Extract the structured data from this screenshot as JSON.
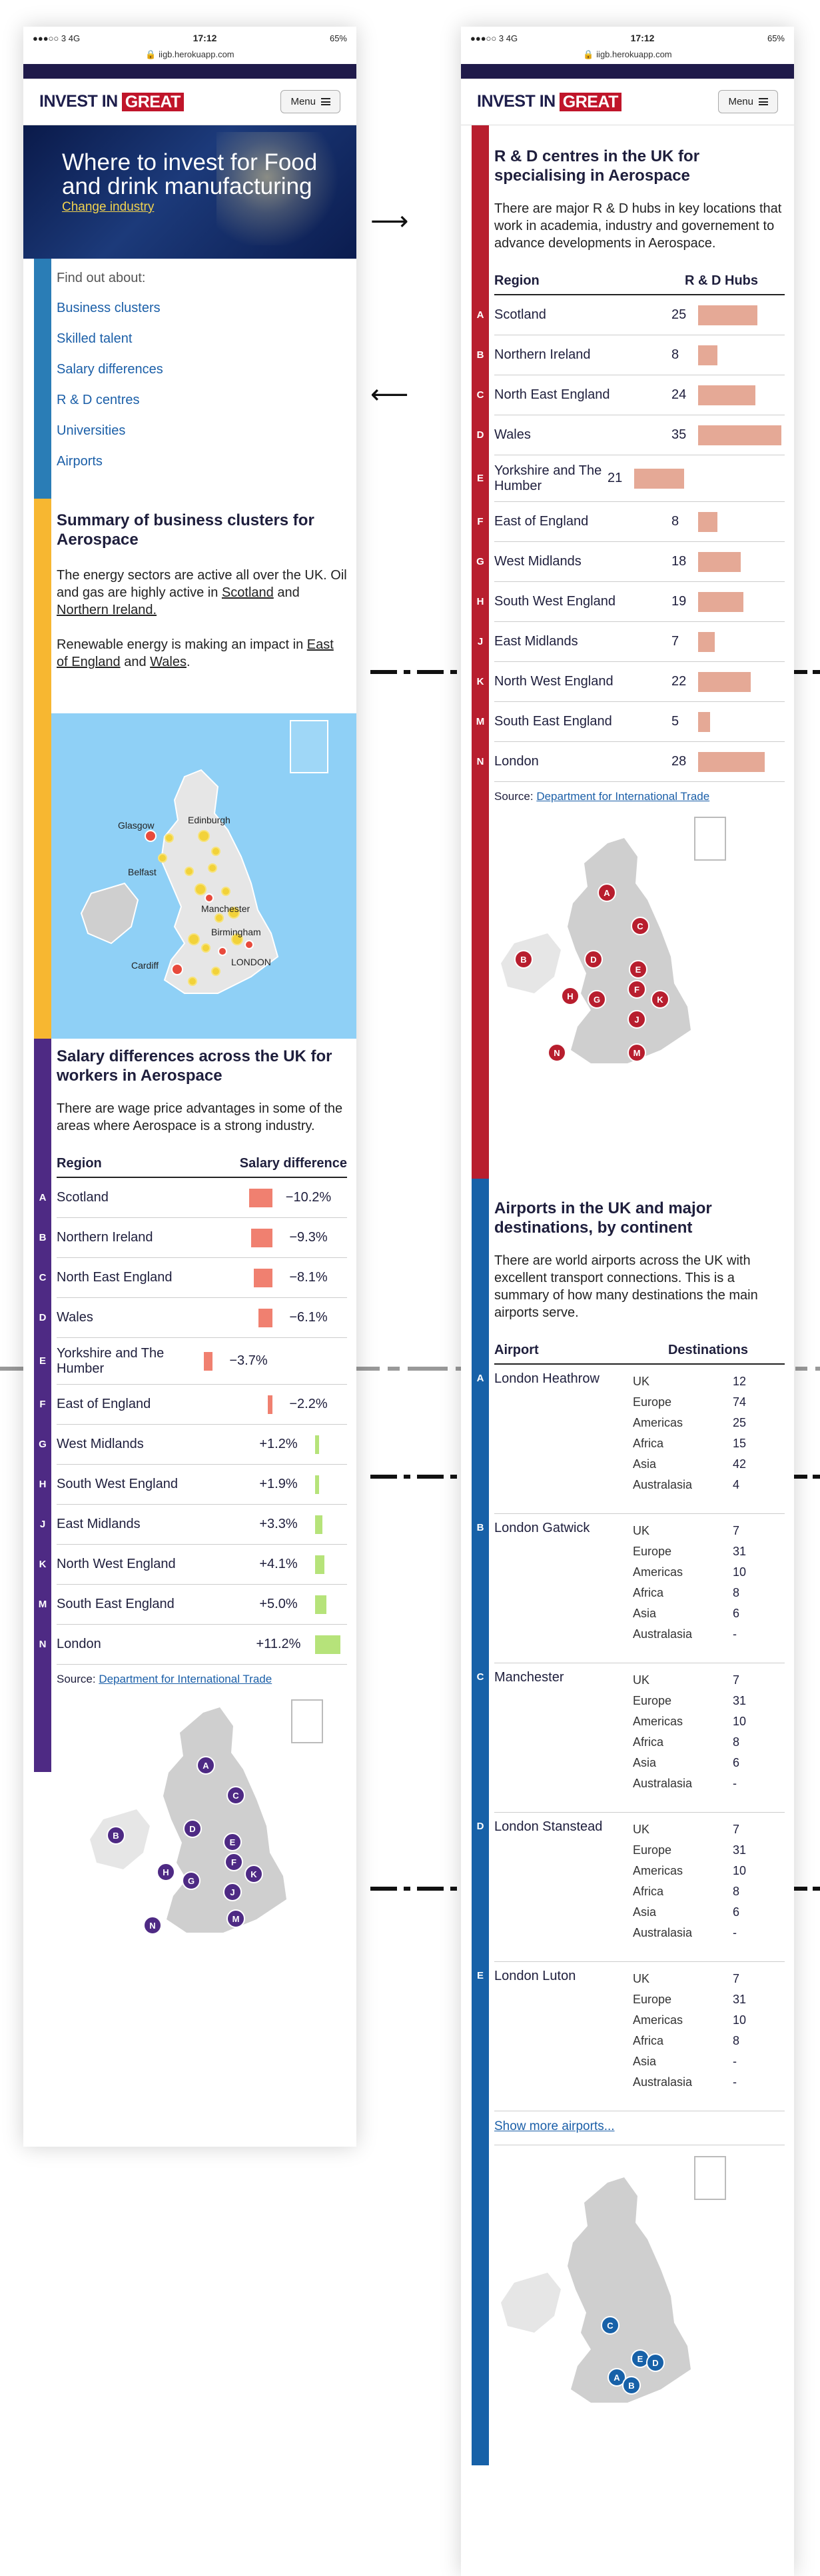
{
  "status": {
    "carrier": "●●●○○ 3  4G",
    "time": "17:12",
    "battery": "65%"
  },
  "url": "iigb.herokuapp.com",
  "logo": {
    "text": "INVEST IN",
    "badge": "GREAT"
  },
  "menu_label": "Menu",
  "hero": {
    "title": "Where to invest for Food and drink manufacturing",
    "change": "Change industry"
  },
  "findout": {
    "label": "Find out about:",
    "links": [
      "Business clusters",
      "Skilled talent",
      "Salary differences",
      "R & D centres",
      "Universities",
      "Airports"
    ]
  },
  "clusters": {
    "title": "Summary of business clusters for Aerospace",
    "p1_pre": "The energy sectors are active all over the UK. Oil and gas are highly active in ",
    "p1_l1": "Scotland",
    "p1_mid": " and ",
    "p1_l2": "Northern Ireland.",
    "p2_pre": "Renewable energy is making an impact in ",
    "p2_l1": "East of England",
    "p2_mid": " and ",
    "p2_l2": "Wales",
    "p2_end": "."
  },
  "cluster_map_labels": [
    "Glasgow",
    "Edinburgh",
    "Belfast",
    "Manchester",
    "Birmingham",
    "Cardiff",
    "LONDON"
  ],
  "salary": {
    "title": "Salary differences across the UK for workers in Aerospace",
    "intro": "There are wage price advantages in some of the areas where Aerospace is a strong industry.",
    "col1": "Region",
    "col2": "Salary difference",
    "rows": [
      {
        "letter": "A",
        "region": "Scotland",
        "value": "−10.2%",
        "num": -10.2
      },
      {
        "letter": "B",
        "region": "Northern Ireland",
        "value": "−9.3%",
        "num": -9.3
      },
      {
        "letter": "C",
        "region": "North East England",
        "value": "−8.1%",
        "num": -8.1
      },
      {
        "letter": "D",
        "region": "Wales",
        "value": "−6.1%",
        "num": -6.1
      },
      {
        "letter": "E",
        "region": "Yorkshire and The Humber",
        "value": "−3.7%",
        "num": -3.7
      },
      {
        "letter": "F",
        "region": "East of England",
        "value": "−2.2%",
        "num": -2.2
      },
      {
        "letter": "G",
        "region": "West Midlands",
        "value": "+1.2%",
        "num": 1.2
      },
      {
        "letter": "H",
        "region": "South West England",
        "value": "+1.9%",
        "num": 1.9
      },
      {
        "letter": "J",
        "region": "East Midlands",
        "value": "+3.3%",
        "num": 3.3
      },
      {
        "letter": "K",
        "region": "North West England",
        "value": "+4.1%",
        "num": 4.1
      },
      {
        "letter": "M",
        "region": "South East England",
        "value": "+5.0%",
        "num": 5.0
      },
      {
        "letter": "N",
        "region": "London",
        "value": "+11.2%",
        "num": 11.2
      }
    ],
    "source_label": "Source: ",
    "source_link": "Department for International Trade"
  },
  "rd": {
    "title": "R & D centres in the UK for specialising in Aerospace",
    "intro": "There are major R & D hubs in key locations that work in academia, industry and governement to advance developments in Aerospace.",
    "col1": "Region",
    "col2": "R & D Hubs",
    "rows": [
      {
        "letter": "A",
        "region": "Scotland",
        "value": "25",
        "num": 25
      },
      {
        "letter": "B",
        "region": "Northern Ireland",
        "value": "8",
        "num": 8
      },
      {
        "letter": "C",
        "region": "North East England",
        "value": "24",
        "num": 24
      },
      {
        "letter": "D",
        "region": "Wales",
        "value": "35",
        "num": 35
      },
      {
        "letter": "E",
        "region": "Yorkshire and The Humber",
        "value": "21",
        "num": 21
      },
      {
        "letter": "F",
        "region": "East of England",
        "value": "8",
        "num": 8
      },
      {
        "letter": "G",
        "region": "West Midlands",
        "value": "18",
        "num": 18
      },
      {
        "letter": "H",
        "region": "South West England",
        "value": "19",
        "num": 19
      },
      {
        "letter": "J",
        "region": "East Midlands",
        "value": "7",
        "num": 7
      },
      {
        "letter": "K",
        "region": "North West England",
        "value": "22",
        "num": 22
      },
      {
        "letter": "M",
        "region": "South East England",
        "value": "5",
        "num": 5
      },
      {
        "letter": "N",
        "region": "London",
        "value": "28",
        "num": 28
      }
    ],
    "source_label": "Source: ",
    "source_link": "Department for International Trade"
  },
  "airports": {
    "title": "Airports in the UK and major destinations, by continent",
    "intro": "There are world airports across the UK with excellent transport connections. This is a summary of how many destinations the main airports serve.",
    "col1": "Airport",
    "col2": "Destinations",
    "continents": [
      "UK",
      "Europe",
      "Americas",
      "Africa",
      "Asia",
      "Australasia"
    ],
    "rows": [
      {
        "letter": "A",
        "name": "London Heathrow",
        "counts": [
          "12",
          "74",
          "25",
          "15",
          "42",
          "4"
        ]
      },
      {
        "letter": "B",
        "name": "London Gatwick",
        "counts": [
          "7",
          "31",
          "10",
          "8",
          "6",
          "-"
        ]
      },
      {
        "letter": "C",
        "name": "Manchester",
        "counts": [
          "7",
          "31",
          "10",
          "8",
          "6",
          "-"
        ]
      },
      {
        "letter": "D",
        "name": "London Stanstead",
        "counts": [
          "7",
          "31",
          "10",
          "8",
          "6",
          "-"
        ]
      },
      {
        "letter": "E",
        "name": "London Luton",
        "counts": [
          "7",
          "31",
          "10",
          "8",
          "-",
          "-"
        ]
      }
    ],
    "more": "Show more airports..."
  },
  "map_letters_purple": [
    "A",
    "B",
    "C",
    "D",
    "E",
    "F",
    "H",
    "G",
    "K",
    "J",
    "N",
    "M"
  ],
  "map_letters_red": [
    "A",
    "B",
    "C",
    "D",
    "E",
    "F",
    "H",
    "G",
    "K",
    "J",
    "N",
    "M"
  ],
  "map_letters_blue": [
    "C",
    "E",
    "D",
    "A",
    "B"
  ],
  "colors": {
    "blue": "#2a7db6",
    "yellow": "#f7b731",
    "purple": "#4e2a84",
    "red": "#b81e2e",
    "navy": "#1761a8",
    "neg": "#f08070",
    "pos": "#b6e37a",
    "hub": "#e5a996"
  }
}
